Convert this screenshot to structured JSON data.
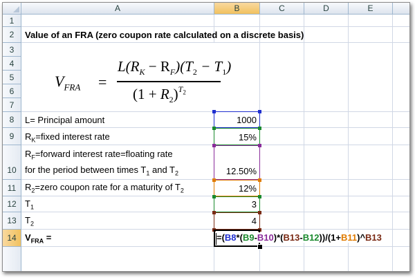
{
  "sheet": {
    "columns": [
      "A",
      "B",
      "C",
      "D",
      "E"
    ],
    "rows": [
      "1",
      "2",
      "3",
      "4",
      "5",
      "6",
      "7",
      "8",
      "9",
      "",
      "10",
      "11",
      "12",
      "13",
      "14"
    ],
    "active_column": "B",
    "active_row": "14"
  },
  "content": {
    "title": "Value of an FRA (zero coupon rate calculated on a discrete basis)",
    "equation": {
      "lhs_v": "V",
      "lhs_sub": "FRA",
      "eq": "=",
      "num": "L(R",
      "num_k": "K",
      "num_mid": " − R",
      "num_f": "F",
      "num_t": ")(T",
      "num_t2": "2",
      "num_minus": " − T",
      "num_t1": "1",
      "num_close": ")",
      "den": "(1 + R",
      "den_2": "2",
      "den_close": ")",
      "den_exp": "T",
      "den_exp_sub": "2"
    },
    "row8_label": "L= Principal amount",
    "row8_value": "1000",
    "row9_pre": "R",
    "row9_sub": "K",
    "row9_post": "=fixed interest rate",
    "row9_value": "15%",
    "row10a_pre": "R",
    "row10a_sub": "F",
    "row10a_post": "=forward interest rate=floating rate",
    "row10b_pre": "for the period between times T",
    "row10b_sub1": "1",
    "row10b_mid": " and T",
    "row10b_sub2": "2",
    "row10_value": "12.50%",
    "row11_pre": "R",
    "row11_sub": "2",
    "row11_post": "=zero coupon rate for a maturity of T",
    "row11_sub2": "2",
    "row11_value": "12%",
    "row12_pre": "T",
    "row12_sub": "1",
    "row12_value": "3",
    "row13_pre": "T",
    "row13_sub": "2",
    "row13_value": "4",
    "row14_pre": "V",
    "row14_sub": "FRA",
    "row14_post": " ="
  },
  "formula": {
    "p1": "=(",
    "ref1": "B8",
    "p2": "*(",
    "ref2": "B9",
    "p3": "-",
    "ref3": "B10",
    "p4": ")*(",
    "ref4": "B13",
    "p5": "-",
    "ref5": "B12",
    "p6": "))/(1+",
    "ref6": "B11",
    "p7": ")^",
    "ref7": "B13"
  },
  "colors": {
    "ref_b8": "#1f2fcf",
    "ref_b9": "#1a8a2e",
    "ref_b10": "#8a2c9a",
    "ref_b11": "#e07b00",
    "ref_b12": "#1a8a2e",
    "ref_b13": "#7a2a14",
    "highlight_header": "#f1c15f",
    "gridline": "#d0d7e5"
  }
}
